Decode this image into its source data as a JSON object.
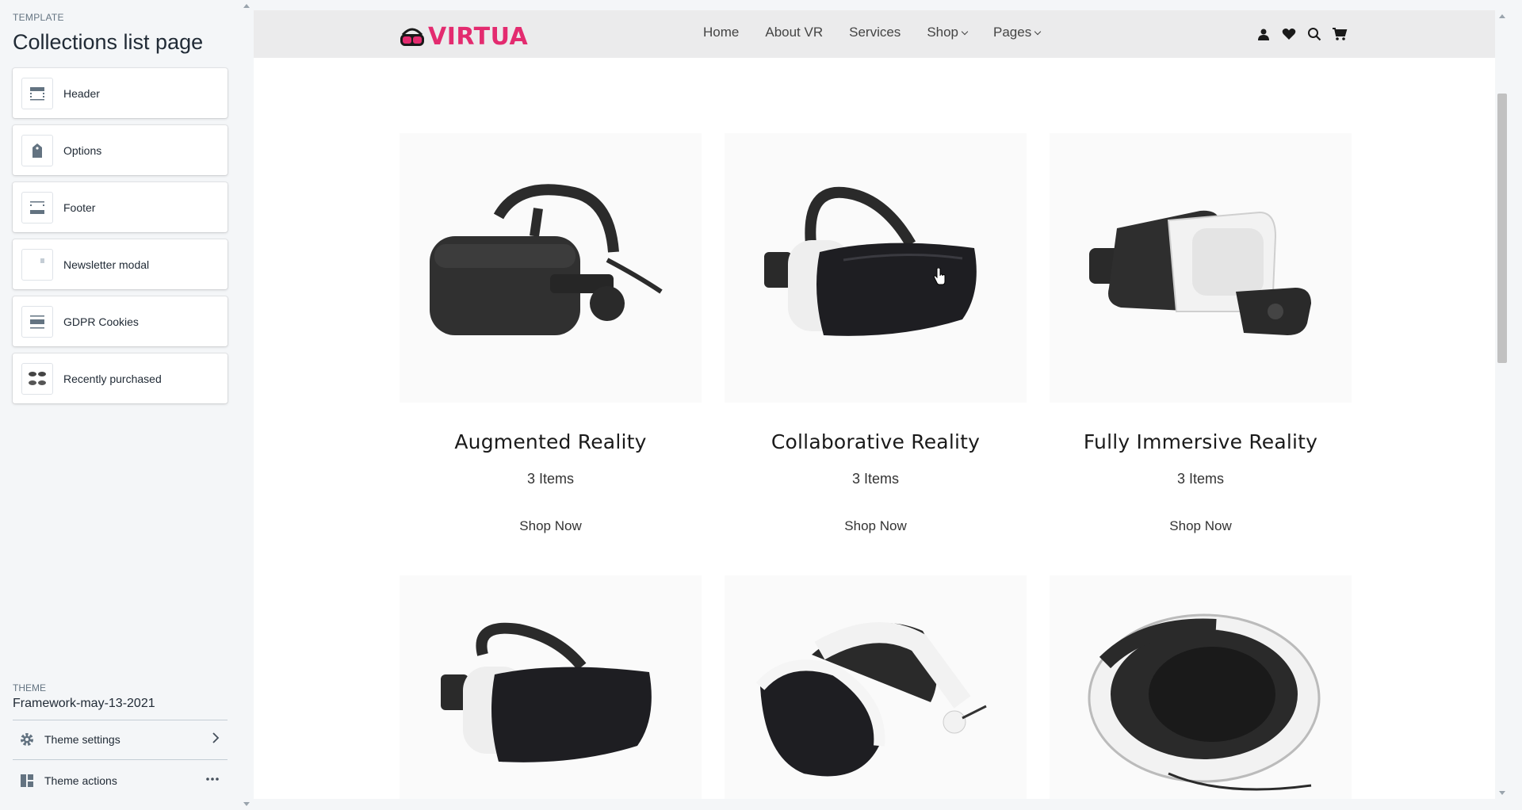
{
  "sidebar": {
    "template_label": "TEMPLATE",
    "template_title": "Collections list page",
    "sections": [
      {
        "label": "Header",
        "icon": "header-section-icon"
      },
      {
        "label": "Options",
        "icon": "tag-icon"
      },
      {
        "label": "Footer",
        "icon": "footer-section-icon"
      },
      {
        "label": "Newsletter modal",
        "icon": "modal-icon"
      },
      {
        "label": "GDPR Cookies",
        "icon": "cookie-bar-icon"
      },
      {
        "label": "Recently purchased",
        "icon": "recently-purchased-icon"
      }
    ],
    "theme_label": "THEME",
    "theme_name": "Framework-may-13-2021",
    "theme_settings": "Theme settings",
    "theme_actions": "Theme actions"
  },
  "site": {
    "logo_text": "VIRTUA",
    "brand_color": "#e32b6f",
    "nav": [
      {
        "label": "Home",
        "dropdown": false
      },
      {
        "label": "About VR",
        "dropdown": false
      },
      {
        "label": "Services",
        "dropdown": false
      },
      {
        "label": "Shop",
        "dropdown": true
      },
      {
        "label": "Pages",
        "dropdown": true
      }
    ],
    "icons": [
      "account-icon",
      "wishlist-heart-icon",
      "search-icon",
      "cart-icon"
    ]
  },
  "collections": [
    {
      "title": "Augmented Reality",
      "count": "3 Items",
      "cta": "Shop Now"
    },
    {
      "title": "Collaborative Reality",
      "count": "3 Items",
      "cta": "Shop Now"
    },
    {
      "title": "Fully Immersive Reality",
      "count": "3 Items",
      "cta": "Shop Now"
    }
  ]
}
